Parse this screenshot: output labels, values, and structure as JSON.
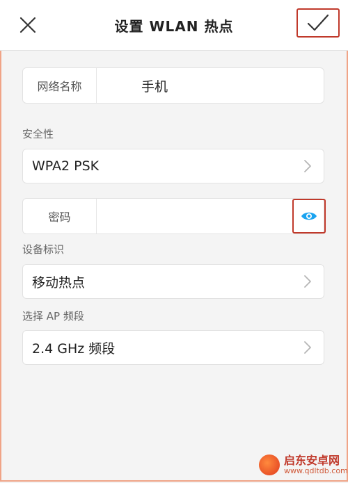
{
  "header": {
    "title": "设置 WLAN 热点"
  },
  "network_name": {
    "label": "网络名称",
    "value": "手机"
  },
  "security": {
    "section_label": "安全性",
    "value": "WPA2 PSK"
  },
  "password": {
    "label": "密码",
    "value": ""
  },
  "device_id": {
    "section_label": "设备标识",
    "value": "移动热点"
  },
  "ap_band": {
    "section_label": "选择 AP 频段",
    "value": "2.4 GHz 频段"
  },
  "watermark": {
    "title": "启东安卓网",
    "url": "www.qdltdb.com"
  },
  "colors": {
    "accent_blue": "#1aa3f0",
    "highlight_red": "#c0392b",
    "frame_orange": "#f0a487"
  },
  "icons": {
    "close": "close-icon",
    "confirm": "checkmark-icon",
    "chevron": "chevron-right-icon",
    "eye": "eye-icon"
  }
}
